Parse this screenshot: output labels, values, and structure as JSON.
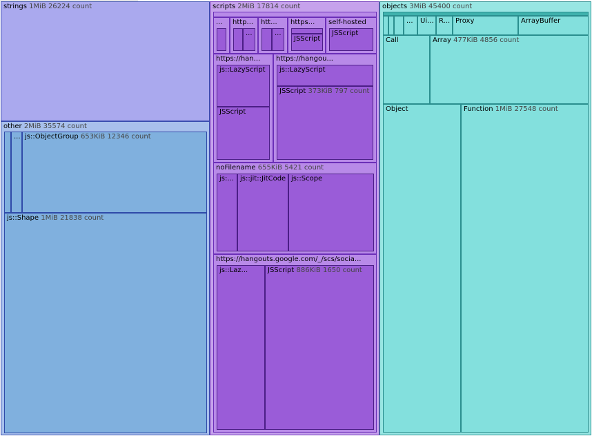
{
  "colors": {
    "strings": "#aaa9ee",
    "other": "#80b0de",
    "scripts": "#9a5cd8",
    "objects": "#83e0dd"
  },
  "strings": {
    "name": "strings",
    "size": "1MiB",
    "count": "26224 count"
  },
  "other": {
    "name": "other",
    "size": "2MiB",
    "count": "35574 count",
    "children": {
      "ellipsis": "...",
      "object_group": {
        "name": "js::ObjectGroup",
        "size": "653KiB",
        "count": "12346 count"
      },
      "shape": {
        "name": "js::Shape",
        "size": "1MiB",
        "count": "21838 count"
      }
    }
  },
  "scripts": {
    "name": "scripts",
    "size": "2MiB",
    "count": "17814 count",
    "top_items": [
      {
        "label": "..."
      },
      {
        "label": "http..."
      },
      {
        "label": "..."
      },
      {
        "label": "htt..."
      },
      {
        "label": "..."
      },
      {
        "label": "https..."
      },
      {
        "label": "JSScript"
      },
      {
        "label": "self-hosted"
      },
      {
        "label": "JSScript"
      }
    ],
    "han1": {
      "label": "https://han...",
      "lazy": "js::LazyScript",
      "jsscript": "JSScript"
    },
    "han2": {
      "label": "https://hangou...",
      "lazy": "js::LazyScript",
      "jsscript": {
        "name": "JSScript",
        "size": "373KiB",
        "count": "797 count"
      }
    },
    "nofilename": {
      "name": "noFilename",
      "size": "655KiB",
      "count": "5421 count",
      "items": [
        "js:...",
        "js::jit::JitCode",
        "js::Scope"
      ]
    },
    "hangouts": {
      "label": "https://hangouts.google.com/_/scs/socia...",
      "lazy": "js::Laz...",
      "jsscript": {
        "name": "JSScript",
        "size": "886KiB",
        "count": "1650 count"
      }
    }
  },
  "objects": {
    "name": "objects",
    "size": "3MiB",
    "count": "45400 count",
    "small": [
      "...",
      "Ui...",
      "R...",
      "Proxy",
      "ArrayBuffer"
    ],
    "call": "Call",
    "array": {
      "name": "Array",
      "size": "477KiB",
      "count": "4856 count"
    },
    "object": "Object",
    "function": {
      "name": "Function",
      "size": "1MiB",
      "count": "27548 count"
    }
  }
}
